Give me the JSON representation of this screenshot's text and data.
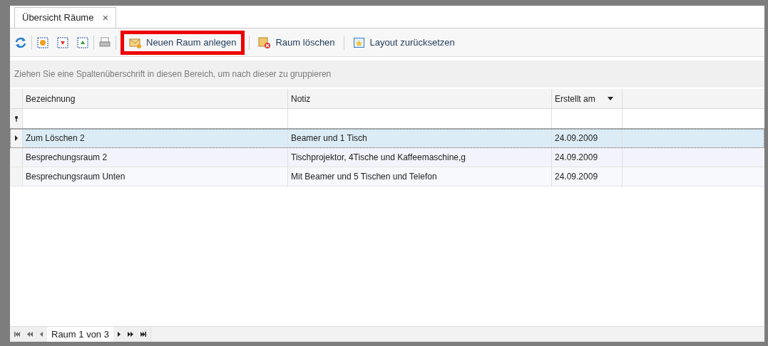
{
  "tab": {
    "label": "Übersicht Räume",
    "close": "×",
    "selected": true
  },
  "toolbar": {
    "buttons": [
      {
        "label": "Neuen Raum anlegen",
        "highlighted": true
      },
      {
        "label": "Raum löschen",
        "highlighted": false
      },
      {
        "label": "Layout zurücksetzen",
        "highlighted": false
      }
    ]
  },
  "group_panel": {
    "hint": "Ziehen Sie eine Spaltenüberschrift in diesen Bereich, um nach dieser zu gruppieren"
  },
  "table": {
    "columns": [
      {
        "label": "Bezeichnung",
        "sorted": false
      },
      {
        "label": "Notiz",
        "sorted": false
      },
      {
        "label": "Erstellt am",
        "sorted": true
      }
    ],
    "rows": [
      {
        "cells": [
          "Zum Löschen 2",
          "Beamer und 1 Tisch",
          "24.09.2009"
        ],
        "selected": true
      },
      {
        "cells": [
          "Besprechungsraum 2",
          "Tischprojektor, 4Tische und Kaffeemaschine,g",
          "24.09.2009"
        ],
        "selected": false
      },
      {
        "cells": [
          "Besprechungsraum Unten",
          "Mit Beamer und 5 Tischen und Telefon",
          "24.09.2009"
        ],
        "selected": false
      }
    ]
  },
  "pager": {
    "label": "Raum 1 von 3"
  }
}
